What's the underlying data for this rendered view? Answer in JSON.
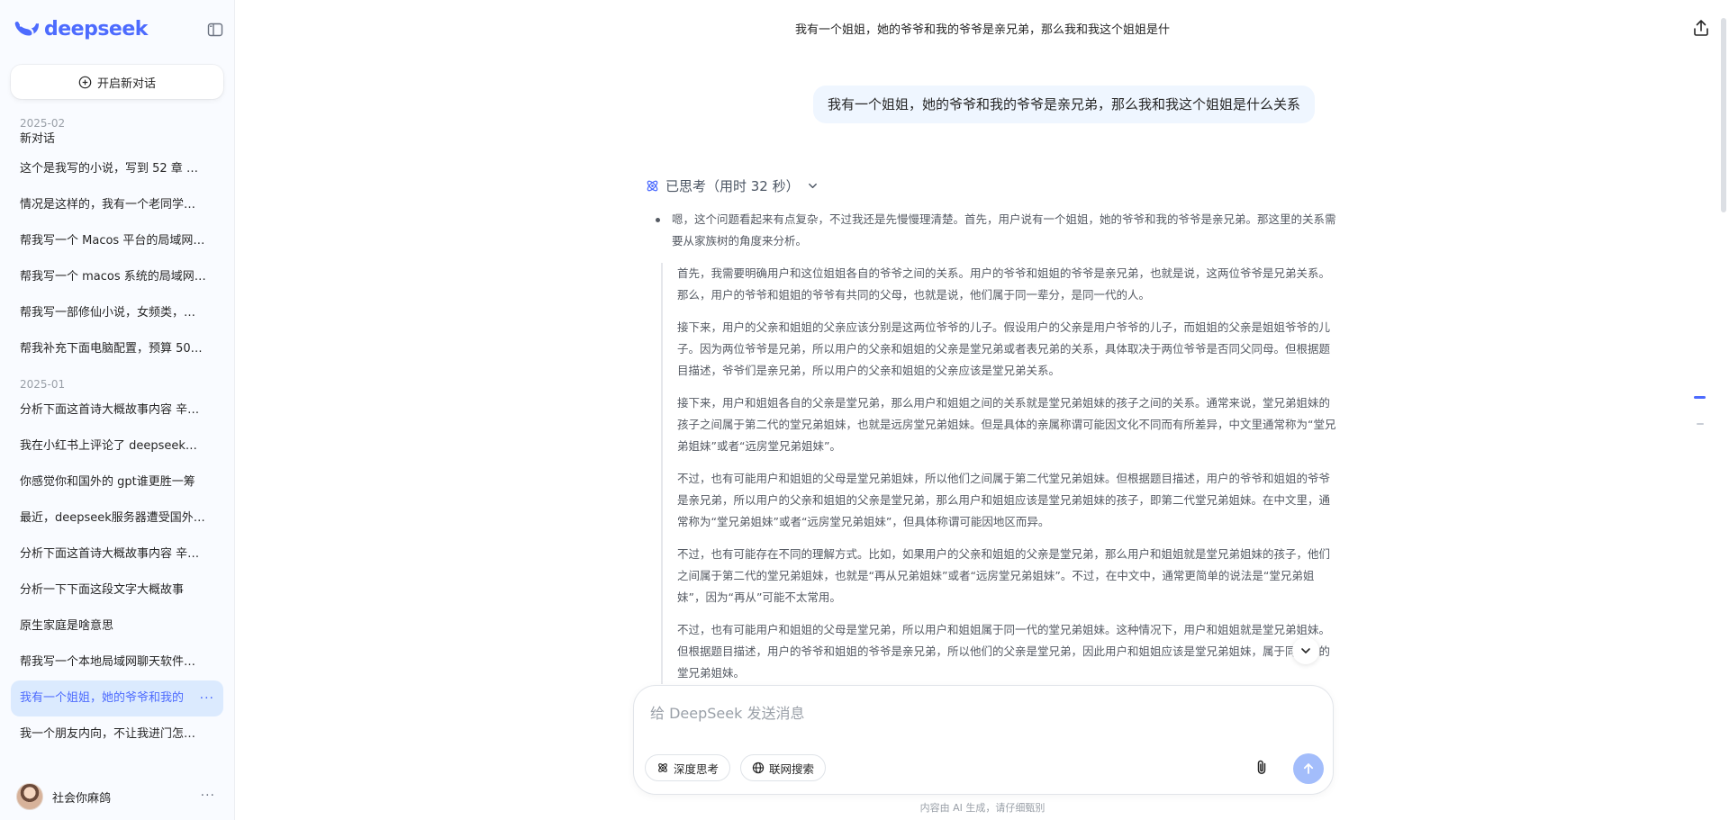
{
  "sidebar": {
    "brand_name": "deepseek",
    "new_chat_label": "开启新对话",
    "groups": [
      {
        "date": "2025-02",
        "items": [
          "新对话",
          "这个是我写的小说，写到 52 章 …",
          "情况是这样的，我有一个老同学…",
          "帮我写一个 Macos 平台的局域网…",
          "帮我写一个 macos 系统的局域网…",
          "帮我写一部修仙小说，女频类，…",
          "帮我补充下面电脑配置，预算 50…"
        ]
      },
      {
        "date": "2025-01",
        "items": [
          "分析下面这首诗大概故事内容 辛…",
          "我在小红书上评论了 deepseek…",
          "你感觉你和国外的 gpt谁更胜一筹",
          "最近，deepseek服务器遭受国外…",
          "分析下面这首诗大概故事内容 辛…",
          "分析一下下面这段文字大概故事",
          "原生家庭是啥意思",
          "帮我写一个本地局域网聊天软件…",
          "我有一个姐姐，她的爷爷和我的",
          "我一个朋友内向，不让我进门怎…"
        ]
      }
    ],
    "active_item_more": "···",
    "user": {
      "name": "社会你麻鸽",
      "more": "···"
    }
  },
  "main": {
    "chat_title": "我有一个姐姐，她的爷爷和我的爷爷是亲兄弟，那么我和我这个姐姐是什",
    "user_message": "我有一个姐姐，她的爷爷和我的爷爷是亲兄弟，那么我和我这个姐姐是什么关系",
    "thought_label": "已思考（用时 32 秒）",
    "thought_lead": "嗯，这个问题看起来有点复杂，不过我还是先慢慢理清楚。首先，用户说有一个姐姐，她的爷爷和我的爷爷是亲兄弟。那这里的关系需要从家族树的角度来分析。",
    "thought_paragraphs": [
      "首先，我需要明确用户和这位姐姐各自的爷爷之间的关系。用户的爷爷和姐姐的爷爷是亲兄弟，也就是说，这两位爷爷是兄弟关系。那么，用户的爷爷和姐姐的爷爷有共同的父母，也就是说，他们属于同一辈分，是同一代的人。",
      "接下来，用户的父亲和姐姐的父亲应该分别是这两位爷爷的儿子。假设用户的父亲是用户爷爷的儿子，而姐姐的父亲是姐姐爷爷的儿子。因为两位爷爷是兄弟，所以用户的父亲和姐姐的父亲是堂兄弟或者表兄弟的关系，具体取决于两位爷爷是否同父同母。但根据题目描述，爷爷们是亲兄弟，所以用户的父亲和姐姐的父亲应该是堂兄弟关系。",
      "接下来，用户和姐姐各自的父亲是堂兄弟，那么用户和姐姐之间的关系就是堂兄弟姐妹的孩子之间的关系。通常来说，堂兄弟姐妹的孩子之间属于第二代的堂兄弟姐妹，也就是远房堂兄弟姐妹。但是具体的亲属称谓可能因文化不同而有所差异，中文里通常称为“堂兄弟姐妹”或者“远房堂兄弟姐妹”。",
      "不过，也有可能用户和姐姐的父母是堂兄弟姐妹，所以他们之间属于第二代堂兄弟姐妹。但根据题目描述，用户的爷爷和姐姐的爷爷是亲兄弟，所以用户的父亲和姐姐的父亲是堂兄弟，那么用户和姐姐应该是堂兄弟姐妹的孩子，即第二代堂兄弟姐妹。在中文里，通常称为“堂兄弟姐妹”或者“远房堂兄弟姐妹”，但具体称谓可能因地区而异。",
      "不过，也有可能存在不同的理解方式。比如，如果用户的父亲和姐姐的父亲是堂兄弟，那么用户和姐姐就是堂兄弟姐妹的孩子，他们之间属于第二代的堂兄弟姐妹，也就是“再从兄弟姐妹”或者“远房堂兄弟姐妹”。不过，在中文中，通常更简单的说法是“堂兄弟姐妹”，因为“再从”可能不太常用。",
      "不过，也有可能用户和姐姐的父母是堂兄弟，所以用户和姐姐属于同一代的堂兄弟姐妹。这种情况下，用户和姐姐就是堂兄弟姐妹。但根据题目描述，用户的爷爷和姐姐的爷爷是亲兄弟，所以他们的父亲是堂兄弟，因此用户和姐姐应该是堂兄弟姐妹，属于同一代的堂兄弟姐妹。"
    ],
    "composer": {
      "placeholder": "给 DeepSeek 发送消息",
      "deep_think_label": "深度思考",
      "web_search_label": "联网搜索"
    },
    "disclaimer": "内容由 AI 生成，请仔细甄别"
  },
  "colors": {
    "accent": "#4d6bfe",
    "active_bg": "#dbeafe",
    "bubble_bg": "#eff6ff",
    "send_disabled": "#a3bdfb"
  },
  "icons": {
    "brand": "whale-logo-icon",
    "collapse": "sidebar-toggle-icon",
    "new_chat": "plus-circle-icon",
    "share": "share-upload-icon",
    "thought": "atom-icon",
    "chevron": "chevron-down-icon",
    "deep_think": "atom-icon",
    "web_search": "globe-icon",
    "attach": "paperclip-icon",
    "send": "arrow-up-icon"
  }
}
